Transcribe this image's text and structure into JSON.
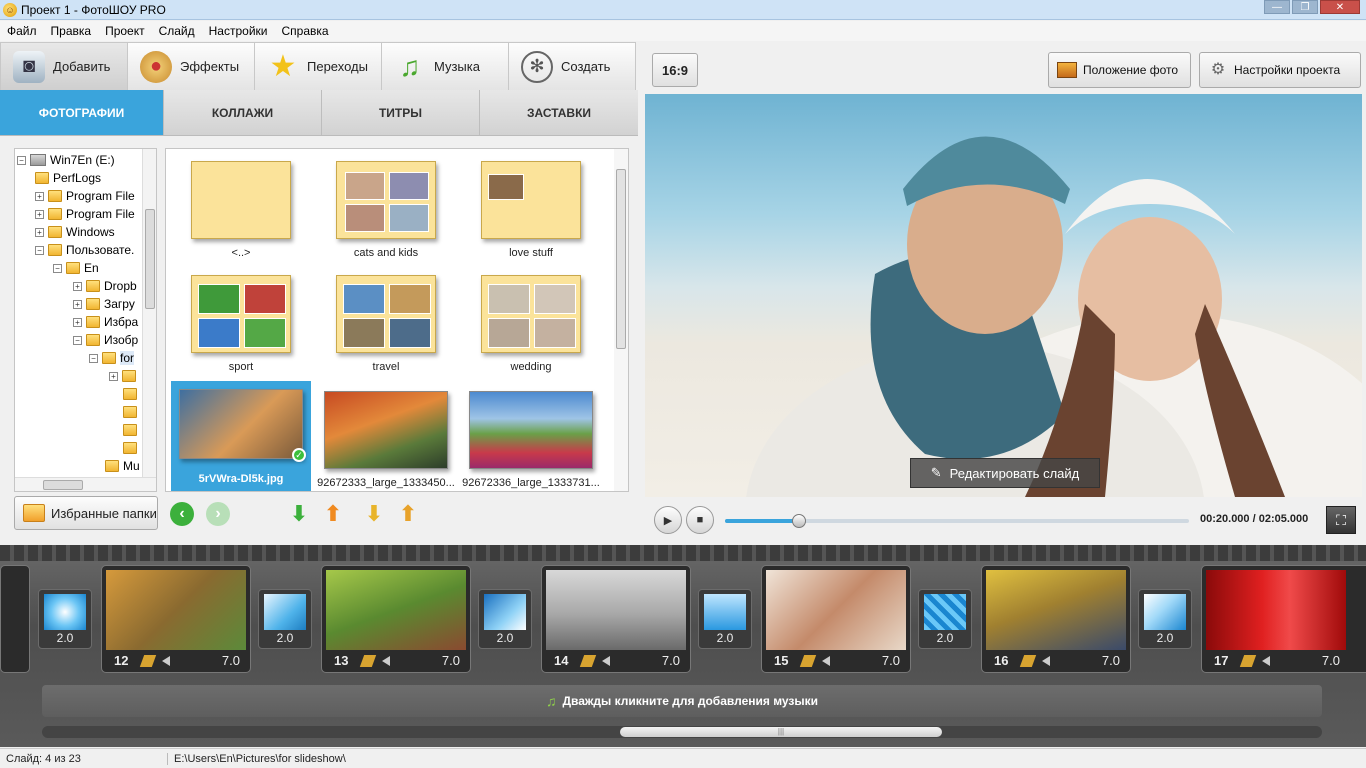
{
  "window": {
    "title": "Проект 1 - ФотоШОУ PRO"
  },
  "menu": [
    "Файл",
    "Правка",
    "Проект",
    "Слайд",
    "Настройки",
    "Справка"
  ],
  "main_tabs": [
    {
      "label": "Добавить",
      "icon": "camera-icon",
      "active": true
    },
    {
      "label": "Эффекты",
      "icon": "palette-icon"
    },
    {
      "label": "Переходы",
      "icon": "star-icon"
    },
    {
      "label": "Музыка",
      "icon": "music-note-icon"
    },
    {
      "label": "Создать",
      "icon": "film-reel-icon"
    }
  ],
  "sub_tabs": [
    {
      "label": "ФОТОГРАФИИ",
      "active": true
    },
    {
      "label": "КОЛЛАЖИ"
    },
    {
      "label": "ТИТРЫ"
    },
    {
      "label": "ЗАСТАВКИ"
    }
  ],
  "tree": [
    {
      "label": "Win7En (E:)",
      "expander": "−"
    },
    {
      "label": "PerfLogs",
      "expander": ""
    },
    {
      "label": "Program File",
      "expander": "+"
    },
    {
      "label": "Program File",
      "expander": "+"
    },
    {
      "label": "Windows",
      "expander": "+"
    },
    {
      "label": "Пользовате.",
      "expander": "−"
    },
    {
      "label": "En",
      "expander": "−"
    },
    {
      "label": "Dropb",
      "expander": "+"
    },
    {
      "label": "Загру",
      "expander": "+"
    },
    {
      "label": "Избра",
      "expander": "+"
    },
    {
      "label": "Изобр",
      "expander": "−"
    },
    {
      "label": "for",
      "expander": "−"
    },
    {
      "label": "",
      "expander": "+"
    },
    {
      "label": "",
      "expander": ""
    },
    {
      "label": "",
      "expander": ""
    },
    {
      "label": "",
      "expander": ""
    },
    {
      "label": "",
      "expander": ""
    },
    {
      "label": "Mu",
      "expander": ""
    }
  ],
  "files": [
    {
      "caption": "<..>",
      "kind": "folder"
    },
    {
      "caption": "cats and kids",
      "kind": "folder"
    },
    {
      "caption": "love stuff",
      "kind": "folder"
    },
    {
      "caption": "sport",
      "kind": "folder"
    },
    {
      "caption": "travel",
      "kind": "folder"
    },
    {
      "caption": "wedding",
      "kind": "folder"
    },
    {
      "caption": "5rVWra-Dl5k.jpg",
      "kind": "photo",
      "selected": true
    },
    {
      "caption": "92672333_large_1333450...",
      "kind": "photo"
    },
    {
      "caption": "92672336_large_1333731...",
      "kind": "photo"
    }
  ],
  "favorites_button": "Избранные папки",
  "aspect_ratio": "16:9",
  "photo_position_button": "Положение фото",
  "project_settings_button": "Настройки проекта",
  "edit_slide_button": "Редактировать слайд",
  "player": {
    "time": "00:20.000 / 02:05.000",
    "progress": 0.16
  },
  "transition_durations": [
    "2.0",
    "2.0",
    "2.0",
    "2.0",
    "2.0",
    "2.0"
  ],
  "slides": [
    {
      "number": "12",
      "duration": "7.0"
    },
    {
      "number": "13",
      "duration": "7.0"
    },
    {
      "number": "14",
      "duration": "7.0"
    },
    {
      "number": "15",
      "duration": "7.0"
    },
    {
      "number": "16",
      "duration": "7.0"
    },
    {
      "number": "17",
      "duration": "7.0"
    }
  ],
  "music_hint": "Дважды кликните для добавления музыки",
  "status": {
    "slide": "Слайд: 4 из 23",
    "path": "E:\\Users\\En\\Pictures\\for slideshow\\"
  },
  "colors": {
    "accent": "#3aa4dc",
    "timeline_bg": "#5a5a5a"
  }
}
